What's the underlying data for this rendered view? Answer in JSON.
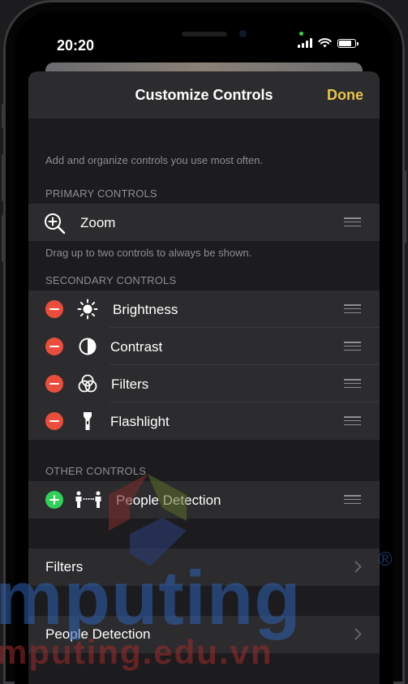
{
  "status_bar": {
    "time": "20:20",
    "battery_level": 0.8
  },
  "header": {
    "title": "Customize Controls",
    "done_label": "Done"
  },
  "description": "Add and organize controls you use most often.",
  "primary": {
    "section_label": "PRIMARY CONTROLS",
    "items": [
      {
        "label": "Zoom",
        "icon": "zoom-icon"
      }
    ],
    "hint": "Drag up to two controls to always be shown."
  },
  "secondary": {
    "section_label": "SECONDARY CONTROLS",
    "items": [
      {
        "label": "Brightness",
        "icon": "brightness-icon"
      },
      {
        "label": "Contrast",
        "icon": "contrast-icon"
      },
      {
        "label": "Filters",
        "icon": "filters-icon"
      },
      {
        "label": "Flashlight",
        "icon": "flashlight-icon"
      }
    ]
  },
  "other": {
    "section_label": "OTHER CONTROLS",
    "items": [
      {
        "label": "People Detection",
        "icon": "people-detection-icon"
      }
    ]
  },
  "nav": [
    {
      "label": "Filters"
    },
    {
      "label": "People Detection"
    }
  ],
  "watermark": {
    "line1": "mputing",
    "line2": "mputing.edu.vn",
    "symbol": "®"
  },
  "colors": {
    "accent": "#e9c44a",
    "remove": "#eb4d3d",
    "add": "#30d158",
    "background": "#1c1c1e",
    "row": "#2c2c2e"
  }
}
